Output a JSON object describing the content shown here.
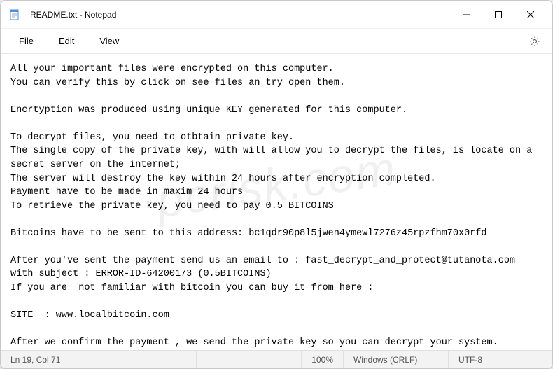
{
  "window": {
    "title": "README.txt - Notepad"
  },
  "menu": {
    "file": "File",
    "edit": "Edit",
    "view": "View"
  },
  "content": "All your important files were encrypted on this computer.\nYou can verify this by click on see files an try open them.\n\nEncrtyption was produced using unique KEY generated for this computer.\n\nTo decrypt files, you need to otbtain private key.\nThe single copy of the private key, with will allow you to decrypt the files, is locate on a secret server on the internet;\nThe server will destroy the key within 24 hours after encryption completed.\nPayment have to be made in maxim 24 hours\nTo retrieve the private key, you need to pay 0.5 BITCOINS\n\nBitcoins have to be sent to this address: bc1qdr90p8l5jwen4ymewl7276z45rpzfhm70x0rfd\n\nAfter you've sent the payment send us an email to : fast_decrypt_and_protect@tutanota.com with subject : ERROR-ID-64200173 (0.5BITCOINS)\nIf you are  not familiar with bitcoin you can buy it from here :\n\nSITE  : www.localbitcoin.com\n\nAfter we confirm the payment , we send the private key so you can decrypt your system.",
  "statusbar": {
    "position": "Ln 19, Col 71",
    "zoom": "100%",
    "line_ending": "Windows (CRLF)",
    "encoding": "UTF-8"
  },
  "watermark": "pcrisk.com"
}
